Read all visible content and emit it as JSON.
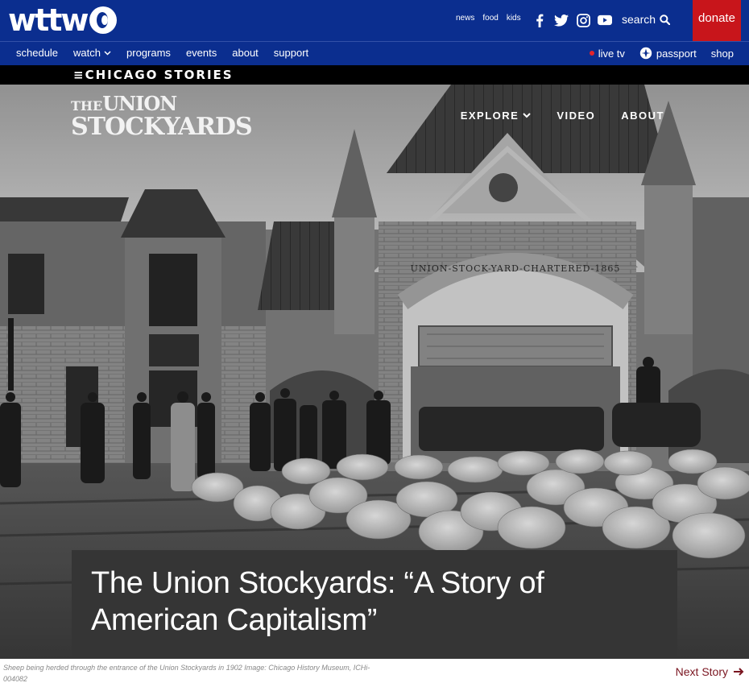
{
  "site": {
    "logo_text": "wttw",
    "top_links": [
      "news",
      "food",
      "kids"
    ],
    "social_icons": [
      "facebook-icon",
      "twitter-icon",
      "instagram-icon",
      "youtube-icon"
    ],
    "search_label": "search",
    "donate_label": "donate",
    "colors": {
      "brand_blue": "#0b2e8f",
      "donate_red": "#c8151b",
      "live_red": "#e3242b",
      "next_story": "#7a1520"
    }
  },
  "nav": {
    "left": [
      {
        "label": "schedule"
      },
      {
        "label": "watch",
        "has_dropdown": true
      },
      {
        "label": "programs"
      },
      {
        "label": "events"
      },
      {
        "label": "about"
      },
      {
        "label": "support"
      }
    ],
    "live_tv": "live tv",
    "passport": "passport",
    "shop": "shop"
  },
  "strip": {
    "brand": "≡CHICAGO STORIES"
  },
  "story": {
    "logo_line1_small": "THE",
    "logo_line1": "UNION",
    "logo_line2": "STOCKYARDS",
    "nav": [
      {
        "label": "EXPLORE",
        "has_dropdown": true
      },
      {
        "label": "VIDEO"
      },
      {
        "label": "ABOUT"
      }
    ],
    "title": "The Union Stockyards: “A Story of American Capitalism”",
    "arch_inscription": "UNION-STOCK-YARD-CHARTERED-1865",
    "caption": "Sheep being herded through the entrance of the Union Stockyards in 1902 Image: Chicago History Museum, ICHi-004082",
    "next_story": "Next Story"
  }
}
